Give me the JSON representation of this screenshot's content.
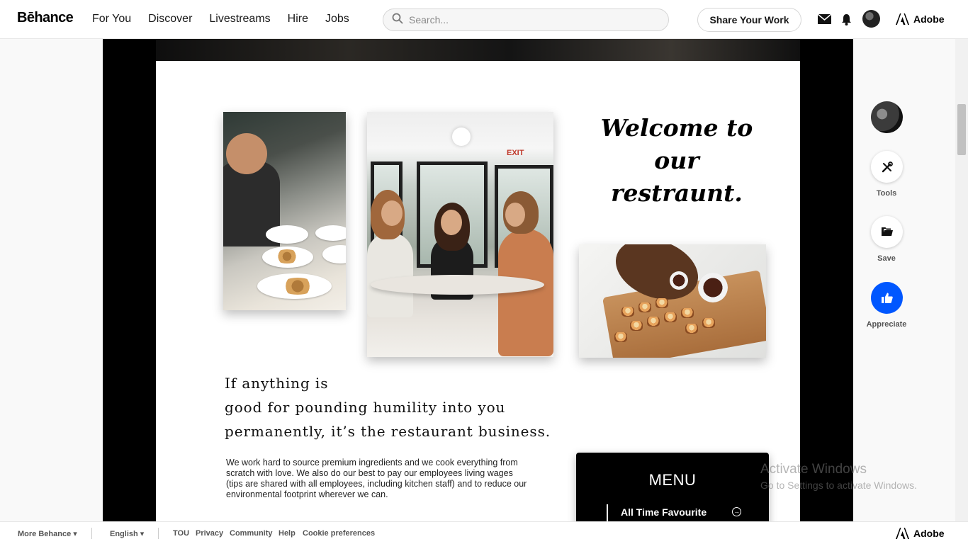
{
  "header": {
    "logo": "Bēhance",
    "nav": [
      "For You",
      "Discover",
      "Livestreams",
      "Hire",
      "Jobs"
    ],
    "search_placeholder": "Search...",
    "share_label": "Share Your Work",
    "adobe_label": "Adobe"
  },
  "project": {
    "welcome": "Welcome to our restraunt.",
    "welcome_lines": [
      "Welcome to",
      "our",
      "restraunt."
    ],
    "exit_sign": "EXIT",
    "quote_lines": [
      "If anything is",
      "good for pounding humility into you",
      "permanently, it’s the restaurant business."
    ],
    "paragraph": "We work hard to source premium ingredients and we cook everything from scratch with love. We also do our best to pay our employees living wages (tips are shared with all employees, including kitchen staff) and to reduce our environmental footprint wherever we can.",
    "menu_title": "MENU",
    "menu_item": "All Time Favourite"
  },
  "rail": {
    "tools_label": "Tools",
    "save_label": "Save",
    "appreciate_label": "Appreciate"
  },
  "watermark": {
    "line1": "Activate Windows",
    "line2": "Go to Settings to activate Windows."
  },
  "footer": {
    "more": "More Behance ▾",
    "language": "English ▾",
    "links": [
      "TOU",
      "Privacy",
      "Community",
      "Help",
      "Cookie preferences"
    ],
    "adobe": "Adobe"
  },
  "colors": {
    "accent_blue": "#0057ff",
    "project_bg": "#000000"
  }
}
